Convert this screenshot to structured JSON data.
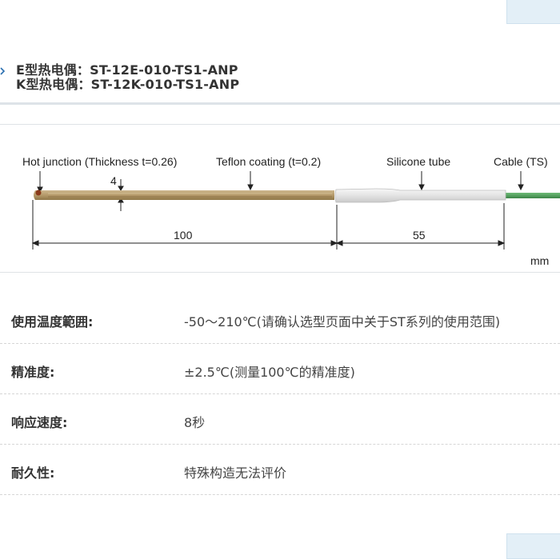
{
  "header": {
    "line1_prefix": "E型热电偶：",
    "line1_model": "ST-12E-010-TS1-ANP",
    "line2_prefix": "K型热电偶：",
    "line2_model": "ST-12K-010-TS1-ANP"
  },
  "diagram": {
    "callouts": {
      "hot_junction": "Hot junction (Thickness t=0.26)",
      "teflon": "Teflon coating (t=0.2)",
      "silicone": "Silicone tube",
      "cable": "Cable (TS)"
    },
    "dims": {
      "thickness": "4",
      "length_probe": "100",
      "length_tube": "55",
      "unit": "mm"
    },
    "colors": {
      "probe": "#b59a6a",
      "tube": "#e6e6e6",
      "cable": "#4f9f5a"
    }
  },
  "specs": [
    {
      "label": "使用温度範囲:",
      "value": "-50～210℃(请确认选型页面中关于ST系列的使用范围)"
    },
    {
      "label": "精准度:",
      "value": "±2.5℃(测量100℃的精准度)"
    },
    {
      "label": "响应速度:",
      "value": "8秒"
    },
    {
      "label": "耐久性:",
      "value": "特殊构造无法评价"
    }
  ],
  "colors": {
    "accent_blue": "#2a6fb0",
    "corner_button_bg": "#e3eff7"
  }
}
